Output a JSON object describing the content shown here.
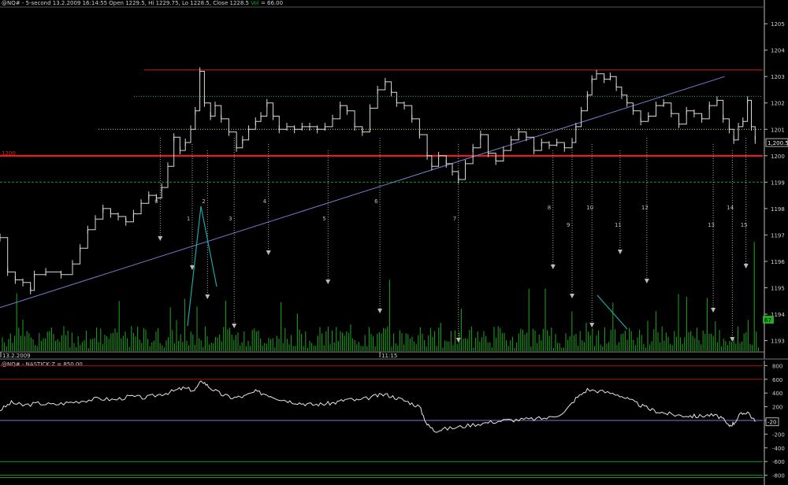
{
  "header": {
    "title": "@NQ# - 5-second 13.2.2009 16:14:55 Open 1229.5, Hi 1229.75, Lo 1228.5, Close 1228.5",
    "volume_label": "Vol",
    "volume_text": "= 66.00"
  },
  "indicator_header": {
    "title": "@NQ# - NASTICK:Z = 850.00"
  },
  "chart_data": [
    {
      "type": "line",
      "title": "",
      "ylim": [
        1192.6,
        1205.6
      ],
      "y_ticks": [
        "1193",
        "1194",
        "1195",
        "1196",
        "1197",
        "1198",
        "1199",
        "1200",
        "1201",
        "1202",
        "1203",
        "1204",
        "1205"
      ],
      "x_labels": [
        {
          "label": "13.2.2009",
          "x": 0
        },
        {
          "label": "11:15",
          "x": 0.497
        }
      ],
      "last_price_label": "1,200.5",
      "left_label": "1200",
      "volume_label": "67",
      "horizontal_lines": [
        {
          "price": 1203.25,
          "color": "#cc2222",
          "style": "solid"
        },
        {
          "price": 1202.25,
          "color": "#18a848",
          "style": "dotted"
        },
        {
          "price": 1201.0,
          "color": "#cfcf5a",
          "style": "dotted"
        },
        {
          "price": 1200.0,
          "color": "#ff1a1a",
          "style": "solid"
        },
        {
          "price": 1199.0,
          "color": "#1a9a1a",
          "style": "dashed"
        }
      ],
      "trendline": {
        "from": {
          "x": 0.0,
          "price": 1194.25
        },
        "to": {
          "x": 0.95,
          "price": 1203.0
        },
        "color": "#7a7ad0"
      },
      "numbered_markers": [
        {
          "label": "0",
          "x": 0.21
        },
        {
          "label": "1",
          "x": 0.252
        },
        {
          "label": "2",
          "x": 0.272
        },
        {
          "label": "3",
          "x": 0.307
        },
        {
          "label": "4",
          "x": 0.352
        },
        {
          "label": "5",
          "x": 0.43
        },
        {
          "label": "6",
          "x": 0.498
        },
        {
          "label": "7",
          "x": 0.601
        },
        {
          "label": "8",
          "x": 0.725
        },
        {
          "label": "9",
          "x": 0.75
        },
        {
          "label": "10",
          "x": 0.776
        },
        {
          "label": "11",
          "x": 0.813
        },
        {
          "label": "12",
          "x": 0.848
        },
        {
          "label": "13",
          "x": 0.935
        },
        {
          "label": "14",
          "x": 0.96
        },
        {
          "label": "15",
          "x": 0.978
        }
      ],
      "price_series": [
        [
          0.0,
          1196.9
        ],
        [
          0.01,
          1195.6
        ],
        [
          0.02,
          1195.3
        ],
        [
          0.03,
          1195.2
        ],
        [
          0.04,
          1194.9
        ],
        [
          0.045,
          1195.5
        ],
        [
          0.06,
          1195.6
        ],
        [
          0.08,
          1195.5
        ],
        [
          0.095,
          1195.9
        ],
        [
          0.105,
          1196.5
        ],
        [
          0.115,
          1197.2
        ],
        [
          0.125,
          1197.6
        ],
        [
          0.135,
          1198.0
        ],
        [
          0.145,
          1197.8
        ],
        [
          0.155,
          1197.7
        ],
        [
          0.165,
          1197.5
        ],
        [
          0.175,
          1197.8
        ],
        [
          0.185,
          1198.2
        ],
        [
          0.195,
          1198.5
        ],
        [
          0.205,
          1198.4
        ],
        [
          0.212,
          1198.8
        ],
        [
          0.22,
          1199.6
        ],
        [
          0.228,
          1200.7
        ],
        [
          0.236,
          1200.2
        ],
        [
          0.243,
          1200.5
        ],
        [
          0.25,
          1201.0
        ],
        [
          0.256,
          1201.7
        ],
        [
          0.262,
          1203.2
        ],
        [
          0.268,
          1202.0
        ],
        [
          0.276,
          1201.5
        ],
        [
          0.282,
          1201.9
        ],
        [
          0.29,
          1201.4
        ],
        [
          0.3,
          1200.9
        ],
        [
          0.31,
          1200.3
        ],
        [
          0.318,
          1200.6
        ],
        [
          0.326,
          1201.0
        ],
        [
          0.335,
          1201.3
        ],
        [
          0.342,
          1201.5
        ],
        [
          0.35,
          1202.0
        ],
        [
          0.358,
          1201.5
        ],
        [
          0.366,
          1201.0
        ],
        [
          0.376,
          1201.1
        ],
        [
          0.386,
          1201.0
        ],
        [
          0.396,
          1201.1
        ],
        [
          0.406,
          1201.1
        ],
        [
          0.416,
          1201.0
        ],
        [
          0.426,
          1201.1
        ],
        [
          0.436,
          1201.4
        ],
        [
          0.446,
          1201.9
        ],
        [
          0.455,
          1201.7
        ],
        [
          0.465,
          1201.1
        ],
        [
          0.475,
          1200.9
        ],
        [
          0.485,
          1201.8
        ],
        [
          0.495,
          1202.5
        ],
        [
          0.505,
          1202.8
        ],
        [
          0.513,
          1202.4
        ],
        [
          0.52,
          1202.0
        ],
        [
          0.53,
          1201.9
        ],
        [
          0.54,
          1201.4
        ],
        [
          0.55,
          1200.8
        ],
        [
          0.56,
          1200.0
        ],
        [
          0.566,
          1199.6
        ],
        [
          0.575,
          1200.0
        ],
        [
          0.585,
          1199.7
        ],
        [
          0.593,
          1199.4
        ],
        [
          0.601,
          1199.1
        ],
        [
          0.61,
          1199.7
        ],
        [
          0.62,
          1200.3
        ],
        [
          0.63,
          1200.8
        ],
        [
          0.64,
          1200.1
        ],
        [
          0.65,
          1199.8
        ],
        [
          0.66,
          1200.2
        ],
        [
          0.67,
          1200.6
        ],
        [
          0.68,
          1200.9
        ],
        [
          0.69,
          1200.7
        ],
        [
          0.7,
          1200.2
        ],
        [
          0.71,
          1200.5
        ],
        [
          0.72,
          1200.4
        ],
        [
          0.73,
          1200.5
        ],
        [
          0.74,
          1200.3
        ],
        [
          0.75,
          1200.5
        ],
        [
          0.755,
          1201.1
        ],
        [
          0.762,
          1201.7
        ],
        [
          0.77,
          1202.3
        ],
        [
          0.776,
          1202.9
        ],
        [
          0.782,
          1203.1
        ],
        [
          0.792,
          1202.9
        ],
        [
          0.8,
          1203.0
        ],
        [
          0.808,
          1202.6
        ],
        [
          0.815,
          1202.3
        ],
        [
          0.822,
          1202.0
        ],
        [
          0.83,
          1201.7
        ],
        [
          0.84,
          1201.3
        ],
        [
          0.85,
          1201.5
        ],
        [
          0.86,
          1201.9
        ],
        [
          0.87,
          1202.0
        ],
        [
          0.88,
          1201.6
        ],
        [
          0.89,
          1201.2
        ],
        [
          0.9,
          1201.7
        ],
        [
          0.91,
          1201.6
        ],
        [
          0.92,
          1201.4
        ],
        [
          0.93,
          1201.9
        ],
        [
          0.94,
          1202.1
        ],
        [
          0.948,
          1201.4
        ],
        [
          0.956,
          1201.0
        ],
        [
          0.962,
          1200.6
        ],
        [
          0.968,
          1201.1
        ],
        [
          0.974,
          1201.3
        ],
        [
          0.98,
          1202.1
        ],
        [
          0.985,
          1201.1
        ],
        [
          0.99,
          1200.6
        ]
      ]
    },
    {
      "type": "line",
      "title": "",
      "ylim": [
        -850,
        850
      ],
      "y_ticks": [
        "800",
        "600",
        "400",
        "200",
        "0",
        "-200",
        "-400",
        "-600",
        "-800"
      ],
      "last_value_label": "-20",
      "horizontal_lines": [
        {
          "value": 800,
          "color": "#aa1111"
        },
        {
          "value": 600,
          "color": "#aa1111"
        },
        {
          "value": 0,
          "color": "#7a7ad0"
        },
        {
          "value": -600,
          "color": "#1a9a1a"
        },
        {
          "value": -800,
          "color": "#1a9a1a"
        }
      ],
      "series": [
        [
          0.0,
          150
        ],
        [
          0.015,
          260
        ],
        [
          0.03,
          220
        ],
        [
          0.05,
          250
        ],
        [
          0.07,
          230
        ],
        [
          0.09,
          260
        ],
        [
          0.11,
          290
        ],
        [
          0.13,
          320
        ],
        [
          0.15,
          300
        ],
        [
          0.17,
          350
        ],
        [
          0.19,
          330
        ],
        [
          0.21,
          380
        ],
        [
          0.225,
          420
        ],
        [
          0.24,
          470
        ],
        [
          0.255,
          440
        ],
        [
          0.265,
          580
        ],
        [
          0.275,
          480
        ],
        [
          0.29,
          380
        ],
        [
          0.305,
          330
        ],
        [
          0.32,
          350
        ],
        [
          0.335,
          420
        ],
        [
          0.35,
          380
        ],
        [
          0.365,
          320
        ],
        [
          0.38,
          280
        ],
        [
          0.395,
          250
        ],
        [
          0.41,
          230
        ],
        [
          0.425,
          240
        ],
        [
          0.44,
          260
        ],
        [
          0.455,
          310
        ],
        [
          0.47,
          290
        ],
        [
          0.49,
          350
        ],
        [
          0.505,
          380
        ],
        [
          0.52,
          330
        ],
        [
          0.535,
          270
        ],
        [
          0.55,
          200
        ],
        [
          0.56,
          -60
        ],
        [
          0.57,
          -150
        ],
        [
          0.58,
          -130
        ],
        [
          0.6,
          -100
        ],
        [
          0.62,
          -60
        ],
        [
          0.64,
          -30
        ],
        [
          0.66,
          0
        ],
        [
          0.68,
          10
        ],
        [
          0.7,
          20
        ],
        [
          0.72,
          40
        ],
        [
          0.74,
          120
        ],
        [
          0.755,
          320
        ],
        [
          0.77,
          450
        ],
        [
          0.79,
          420
        ],
        [
          0.81,
          380
        ],
        [
          0.825,
          300
        ],
        [
          0.84,
          220
        ],
        [
          0.855,
          150
        ],
        [
          0.87,
          110
        ],
        [
          0.885,
          80
        ],
        [
          0.9,
          70
        ],
        [
          0.915,
          60
        ],
        [
          0.93,
          80
        ],
        [
          0.945,
          50
        ],
        [
          0.955,
          -80
        ],
        [
          0.962,
          -40
        ],
        [
          0.97,
          80
        ],
        [
          0.98,
          130
        ],
        [
          0.99,
          -20
        ]
      ]
    }
  ],
  "colors": {
    "background": "#000000",
    "price_bars": "#d8d8d8",
    "volume": "#1a9a1a",
    "marker_lines": "#cfcfcf",
    "annotation_lines": "#1aa6a6",
    "axis_text": "#cfcfcf"
  }
}
